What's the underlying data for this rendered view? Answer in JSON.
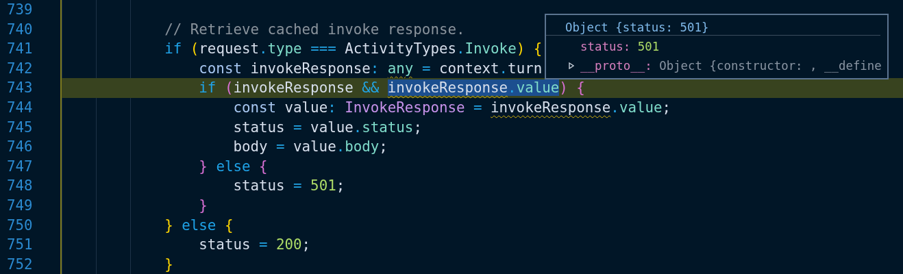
{
  "editor": {
    "lines": [
      {
        "number": "739",
        "highlighted": false
      },
      {
        "number": "740",
        "highlighted": false,
        "tokens": [
          {
            "t": "            // Retrieve cached invoke response.",
            "kind": "comment"
          }
        ]
      },
      {
        "number": "741",
        "highlighted": false,
        "tokens": [
          {
            "t": "            if ",
            "kind": "keyword"
          },
          {
            "t": "(",
            "kind": "bracket1"
          },
          {
            "t": "request",
            "kind": "plain"
          },
          {
            "t": ".",
            "kind": "operator"
          },
          {
            "t": "type ",
            "kind": "property"
          },
          {
            "t": "===",
            "kind": "operator"
          },
          {
            "t": " ActivityTypes",
            "kind": "plain"
          },
          {
            "t": ".",
            "kind": "operator"
          },
          {
            "t": "Invoke",
            "kind": "property"
          },
          {
            "t": ") {",
            "kind": "bracket1"
          }
        ]
      },
      {
        "number": "742",
        "highlighted": false,
        "tokens": [
          {
            "t": "                const",
            "kind": "storage"
          },
          {
            "t": " invokeResponse",
            "kind": "plain"
          },
          {
            "t": ": ",
            "kind": "operator"
          },
          {
            "t": "any",
            "kind": "property",
            "warning": true
          },
          {
            "t": " = ",
            "kind": "operator"
          },
          {
            "t": "context",
            "kind": "plain"
          },
          {
            "t": ".",
            "kind": "operator"
          },
          {
            "t": "turn",
            "kind": "plain"
          }
        ]
      },
      {
        "number": "743",
        "highlighted": true,
        "tokens": [
          {
            "t": "                if ",
            "kind": "keyword"
          },
          {
            "t": "(",
            "kind": "bracket2"
          },
          {
            "t": "invokeResponse ",
            "kind": "plain"
          },
          {
            "t": "&& ",
            "kind": "operator"
          },
          {
            "t": "invokeResponse",
            "kind": "plain",
            "warning": true,
            "selected": true
          },
          {
            "t": ".",
            "kind": "operator",
            "selected": true
          },
          {
            "t": "value",
            "kind": "property",
            "selected": true
          },
          {
            "t": ") {",
            "kind": "bracket2"
          }
        ]
      },
      {
        "number": "744",
        "highlighted": false,
        "tokens": [
          {
            "t": "                    const",
            "kind": "storage"
          },
          {
            "t": " value",
            "kind": "plain"
          },
          {
            "t": ": ",
            "kind": "operator"
          },
          {
            "t": "InvokeResponse",
            "kind": "type"
          },
          {
            "t": " = ",
            "kind": "operator"
          },
          {
            "t": "invokeResponse",
            "kind": "plain",
            "warning": true
          },
          {
            "t": ".",
            "kind": "operator"
          },
          {
            "t": "value",
            "kind": "property"
          },
          {
            "t": ";",
            "kind": "plain"
          }
        ]
      },
      {
        "number": "745",
        "highlighted": false,
        "tokens": [
          {
            "t": "                    status",
            "kind": "plain"
          },
          {
            "t": " = ",
            "kind": "operator"
          },
          {
            "t": "value",
            "kind": "plain"
          },
          {
            "t": ".",
            "kind": "operator"
          },
          {
            "t": "status",
            "kind": "property"
          },
          {
            "t": ";",
            "kind": "plain"
          }
        ]
      },
      {
        "number": "746",
        "highlighted": false,
        "tokens": [
          {
            "t": "                    body",
            "kind": "plain"
          },
          {
            "t": " = ",
            "kind": "operator"
          },
          {
            "t": "value",
            "kind": "plain"
          },
          {
            "t": ".",
            "kind": "operator"
          },
          {
            "t": "body",
            "kind": "property"
          },
          {
            "t": ";",
            "kind": "plain"
          }
        ]
      },
      {
        "number": "747",
        "highlighted": false,
        "tokens": [
          {
            "t": "                }",
            "kind": "bracket2"
          },
          {
            "t": " else ",
            "kind": "keyword"
          },
          {
            "t": "{",
            "kind": "bracket2"
          }
        ]
      },
      {
        "number": "748",
        "highlighted": false,
        "tokens": [
          {
            "t": "                    status",
            "kind": "plain"
          },
          {
            "t": " = ",
            "kind": "operator"
          },
          {
            "t": "501",
            "kind": "number"
          },
          {
            "t": ";",
            "kind": "plain"
          }
        ]
      },
      {
        "number": "749",
        "highlighted": false,
        "tokens": [
          {
            "t": "                }",
            "kind": "bracket2"
          }
        ]
      },
      {
        "number": "750",
        "highlighted": false,
        "tokens": [
          {
            "t": "            }",
            "kind": "bracket1"
          },
          {
            "t": " else ",
            "kind": "keyword"
          },
          {
            "t": "{",
            "kind": "bracket1"
          }
        ]
      },
      {
        "number": "751",
        "highlighted": false,
        "tokens": [
          {
            "t": "                status",
            "kind": "plain"
          },
          {
            "t": " = ",
            "kind": "operator"
          },
          {
            "t": "200",
            "kind": "number"
          },
          {
            "t": ";",
            "kind": "plain"
          }
        ]
      },
      {
        "number": "752",
        "highlighted": false,
        "tokens": [
          {
            "t": "            }",
            "kind": "bracket1"
          }
        ]
      }
    ]
  },
  "hover": {
    "title": "Object {status: 501}",
    "properties": [
      {
        "key": "status:",
        "value": "501",
        "kind": "number",
        "expandable": false
      },
      {
        "key": "__proto__:",
        "value": "Object {constructor: , __define",
        "kind": "object",
        "expandable": true
      }
    ]
  }
}
